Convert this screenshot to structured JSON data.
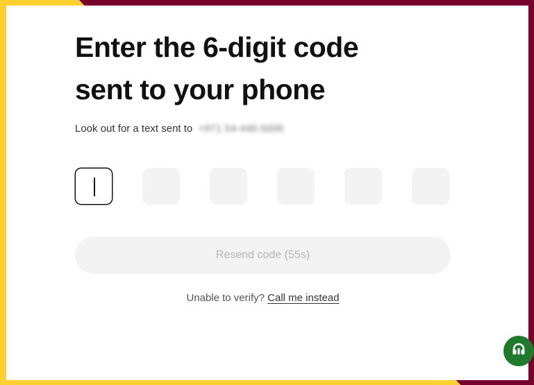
{
  "page": {
    "title_line1": "Enter the 6-digit code",
    "title_line2": "sent to your phone",
    "subtitle_prefix": "Look out for a text sent to",
    "phone_masked": "+971 54-446-5006"
  },
  "code_inputs": [
    "",
    "",
    "",
    "",
    "",
    ""
  ],
  "resend": {
    "label": "Resend code (55s)"
  },
  "alternate": {
    "prompt": "Unable to verify?",
    "link": "Call me instead"
  },
  "support": {
    "icon": "headset-icon"
  },
  "colors": {
    "frame_yellow": "#fed02f",
    "frame_maroon": "#76002b",
    "support_green": "#1f7a2b",
    "input_bg": "#f3f3f3"
  }
}
